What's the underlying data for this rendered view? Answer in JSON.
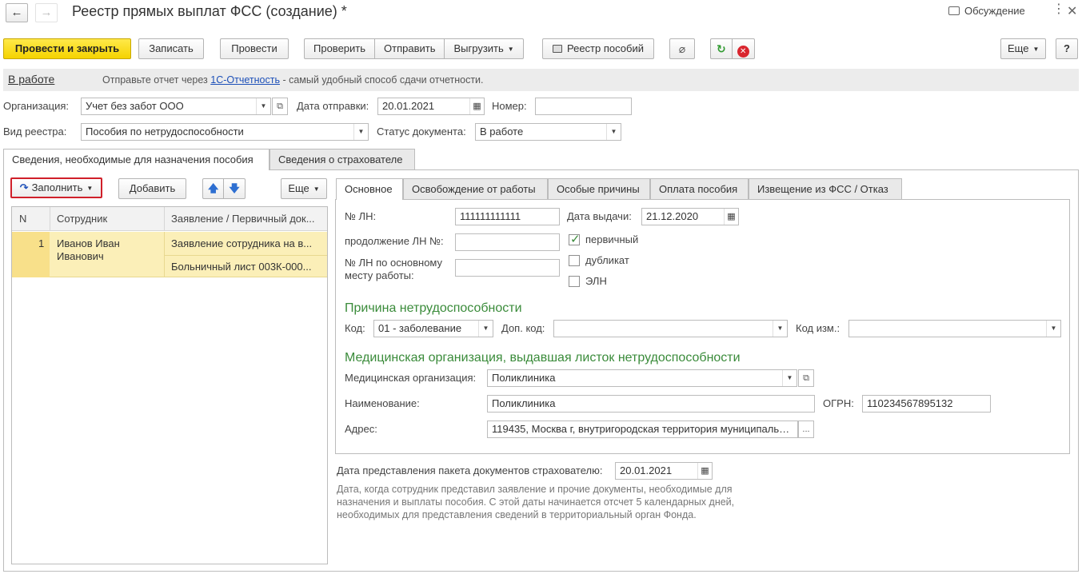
{
  "window": {
    "title": "Реестр прямых выплат ФСС (создание) *",
    "discussion_label": "Обсуждение"
  },
  "toolbar": {
    "post_close": "Провести и закрыть",
    "save": "Записать",
    "post": "Провести",
    "check": "Проверить",
    "send": "Отправить",
    "export": "Выгрузить",
    "benefits_registry": "Реестр пособий",
    "more": "Еще",
    "help": "?"
  },
  "info_bar": {
    "status_link": "В работе",
    "text_before": "Отправьте отчет через ",
    "link": "1С-Отчетность",
    "text_after": " - самый удобный способ сдачи отчетности."
  },
  "header_fields": {
    "organization": {
      "label": "Организация:",
      "value": "Учет без забот ООО"
    },
    "send_date": {
      "label": "Дата отправки:",
      "value": "20.01.2021"
    },
    "number": {
      "label": "Номер:",
      "value": ""
    },
    "registry_type": {
      "label": "Вид реестра:",
      "value": "Пособия по нетрудоспособности"
    },
    "doc_status": {
      "label": "Статус документа:",
      "value": "В работе"
    }
  },
  "main_tabs": [
    {
      "label": "Сведения, необходимые для назначения пособия",
      "active": true
    },
    {
      "label": "Сведения о страхователе",
      "active": false
    }
  ],
  "left_panel": {
    "fill": "Заполнить",
    "add": "Добавить",
    "more": "Еще",
    "columns": [
      "N",
      "Сотрудник",
      "Заявление / Первичный док..."
    ],
    "rows": [
      {
        "n": "1",
        "employee": "Иванов Иван Иванович",
        "doc1": "Заявление сотрудника на в...",
        "doc2": "Больничный лист 003К-000..."
      }
    ]
  },
  "detail_tabs": [
    {
      "label": "Основное",
      "active": true
    },
    {
      "label": "Освобождение от работы",
      "active": false
    },
    {
      "label": "Особые причины",
      "active": false
    },
    {
      "label": "Оплата пособия",
      "active": false
    },
    {
      "label": "Извещение из ФСС / Отказ",
      "active": false
    }
  ],
  "sick_leave": {
    "ln_label": "№ ЛН:",
    "ln_value": "111111111111",
    "issue_date_label": "Дата выдачи:",
    "issue_date": "21.12.2020",
    "continuation_label": "продолжение ЛН №:",
    "continuation_value": "",
    "main_ln_label_1": "№ ЛН по основному",
    "main_ln_label_2": "месту работы:",
    "main_ln_value": "",
    "primary_label": "первичный",
    "primary_checked": true,
    "duplicate_label": "дубликат",
    "duplicate_checked": false,
    "eln_label": "ЭЛН",
    "eln_checked": false
  },
  "reason": {
    "title": "Причина нетрудоспособности",
    "code_label": "Код:",
    "code_value": "01 - заболевание",
    "extra_code_label": "Доп. код:",
    "extra_code_value": "",
    "change_code_label": "Код изм.:",
    "change_code_value": ""
  },
  "medical": {
    "title": "Медицинская организация, выдавшая листок нетрудоспособности",
    "org_label": "Медицинская организация:",
    "org_value": "Поликлиника",
    "name_label": "Наименование:",
    "name_value": "Поликлиника",
    "ogrn_label": "ОГРН:",
    "ogrn_value": "110234567895132",
    "address_label": "Адрес:",
    "address_value": "119435, Москва г, внутригородская территория муниципальн...",
    "address_btn": "..."
  },
  "package": {
    "label": "Дата представления пакета документов страхователю:",
    "value": "20.01.2021",
    "hint_1": "Дата, когда сотрудник представил заявление и прочие документы, необходимые для",
    "hint_2": "назначения и выплаты пособия. С этой даты начинается отсчет 5 календарных дней,",
    "hint_3": "необходимых для представления сведений в территориальный орган Фонда."
  },
  "colors": {
    "primary_button": "#f5d300",
    "selected_row": "#fbefb8",
    "selected_cell": "#f8e08a",
    "section_title": "#3a8b3a",
    "highlight_border": "#d0202a",
    "link": "#1c4fb8"
  }
}
